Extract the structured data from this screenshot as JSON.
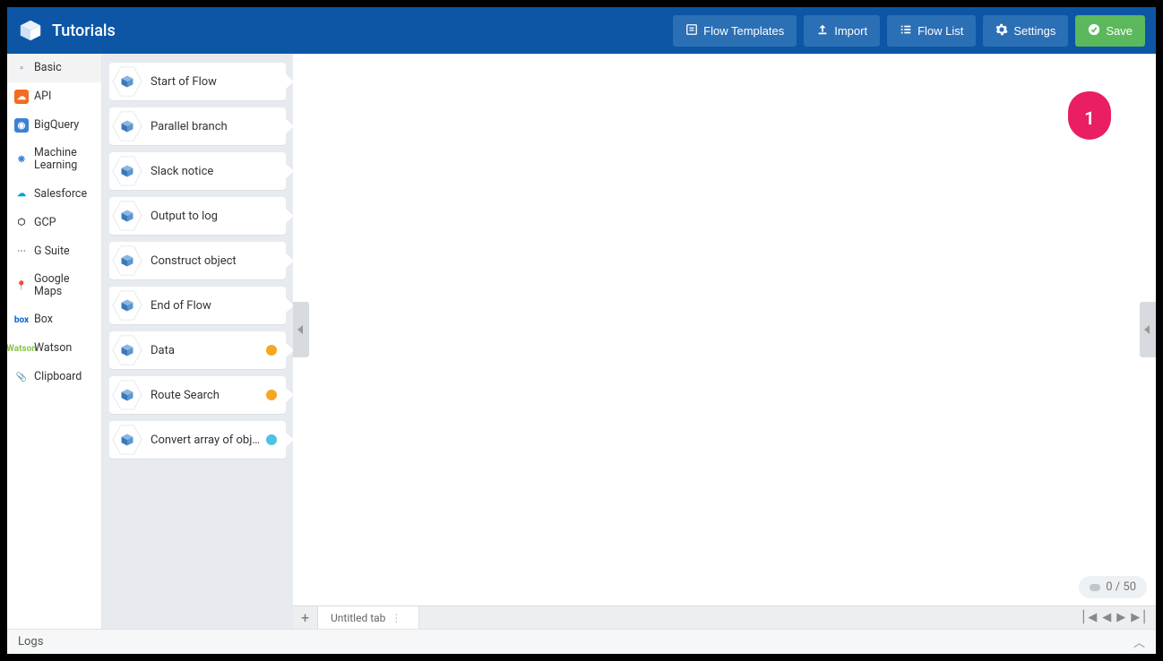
{
  "header": {
    "title": "Tutorials",
    "buttons": {
      "flow_templates": "Flow Templates",
      "import": "Import",
      "flow_list": "Flow List",
      "settings": "Settings",
      "save": "Save"
    }
  },
  "sidebar": {
    "items": [
      {
        "label": "Basic",
        "icon": "basic"
      },
      {
        "label": "API",
        "icon": "api"
      },
      {
        "label": "BigQuery",
        "icon": "bq"
      },
      {
        "label": "Machine Learning",
        "icon": "ml"
      },
      {
        "label": "Salesforce",
        "icon": "sf"
      },
      {
        "label": "GCP",
        "icon": "gcp"
      },
      {
        "label": "G Suite",
        "icon": "gsuite"
      },
      {
        "label": "Google Maps",
        "icon": "maps"
      },
      {
        "label": "Box",
        "icon": "box"
      },
      {
        "label": "Watson",
        "icon": "watson"
      },
      {
        "label": "Clipboard",
        "icon": "clip"
      }
    ]
  },
  "palette": {
    "nodes": [
      {
        "label": "Start of Flow",
        "badge": null
      },
      {
        "label": "Parallel branch",
        "badge": null
      },
      {
        "label": "Slack notice",
        "badge": null
      },
      {
        "label": "Output to log",
        "badge": null
      },
      {
        "label": "Construct object",
        "badge": null
      },
      {
        "label": "End of Flow",
        "badge": null
      },
      {
        "label": "Data",
        "badge": "orange"
      },
      {
        "label": "Route Search",
        "badge": "orange"
      },
      {
        "label": "Convert array of objects",
        "badge": "cyan"
      }
    ]
  },
  "canvas": {
    "annotation_number": "1",
    "counter": "0 / 50"
  },
  "tabs": {
    "current": "Untitled tab"
  },
  "footer": {
    "logs": "Logs"
  }
}
